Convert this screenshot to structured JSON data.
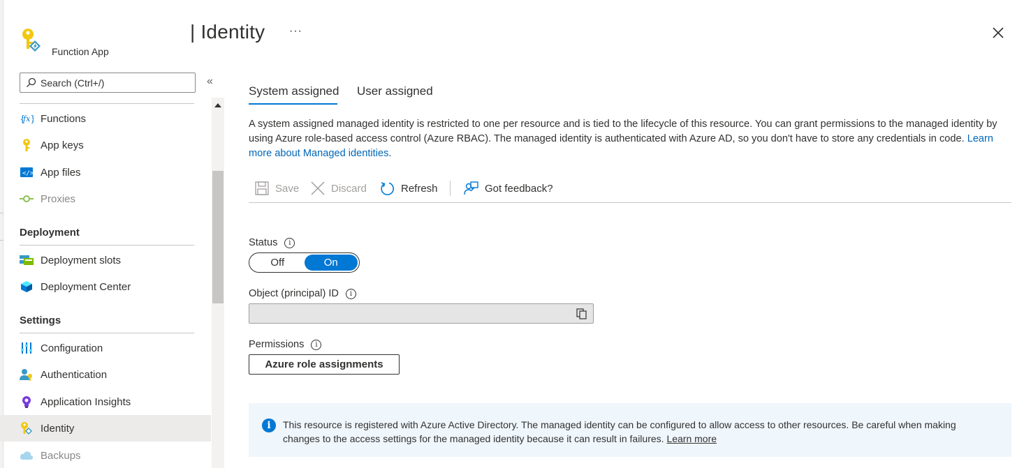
{
  "header": {
    "title": "| Identity",
    "subtitle": "Function App",
    "more_label": "···",
    "app_icon": "key-icon",
    "close_icon": "close-icon"
  },
  "sidebar": {
    "search": {
      "placeholder": "Search (Ctrl+/)",
      "value": ""
    },
    "collapse_label": "«",
    "items_top": [
      {
        "label": "Functions",
        "icon": "function-icon"
      },
      {
        "label": "App keys",
        "icon": "key-icon"
      },
      {
        "label": "App files",
        "icon": "code-file-icon"
      },
      {
        "label": "Proxies",
        "icon": "proxy-icon",
        "disabled": true
      }
    ],
    "sections": [
      {
        "heading": "Deployment",
        "items": [
          {
            "label": "Deployment slots",
            "icon": "deployment-slots-icon"
          },
          {
            "label": "Deployment Center",
            "icon": "cube-icon"
          }
        ]
      },
      {
        "heading": "Settings",
        "items": [
          {
            "label": "Configuration",
            "icon": "sliders-icon"
          },
          {
            "label": "Authentication",
            "icon": "user-key-icon"
          },
          {
            "label": "Application Insights",
            "icon": "lightbulb-icon"
          },
          {
            "label": "Identity",
            "icon": "identity-key-icon",
            "selected": true
          },
          {
            "label": "Backups",
            "icon": "cloud-icon",
            "disabled": true
          }
        ]
      }
    ]
  },
  "tabs": [
    {
      "label": "System assigned",
      "active": true
    },
    {
      "label": "User assigned",
      "active": false
    }
  ],
  "description": {
    "text": "A system assigned managed identity is restricted to one per resource and is tied to the lifecycle of this resource. You can grant permissions to the managed identity by using Azure role-based access control (Azure RBAC). The managed identity is authenticated with Azure AD, so you don't have to store any credentials in code. ",
    "link": "Learn more about Managed identities",
    "suffix": "."
  },
  "toolbar": {
    "save": "Save",
    "discard": "Discard",
    "refresh": "Refresh",
    "feedback": "Got feedback?"
  },
  "status": {
    "label": "Status",
    "off": "Off",
    "on": "On",
    "value": "On"
  },
  "object_id": {
    "label": "Object (principal) ID",
    "value": ""
  },
  "permissions": {
    "label": "Permissions",
    "button": "Azure role assignments"
  },
  "info_bar": {
    "text": "This resource is registered with Azure Active Directory. The managed identity can be configured to allow access to other resources. Be careful when making changes to the access settings for the managed identity because it can result in failures. ",
    "link": "Learn more"
  },
  "colors": {
    "accent": "#0078d4",
    "link": "#0067b8",
    "info_bg": "#eff6fc",
    "selected_bg": "#edebe9"
  }
}
